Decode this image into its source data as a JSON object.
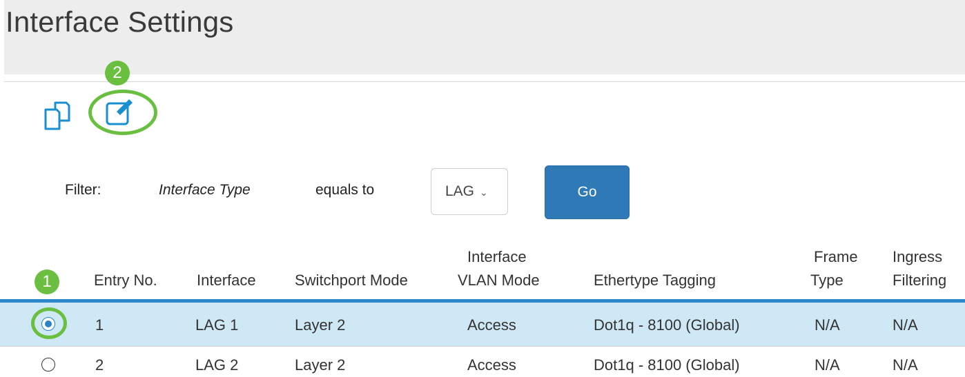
{
  "page": {
    "title": "Interface Settings"
  },
  "toolbar": {
    "copy_icon": "copy-settings-icon",
    "edit_icon": "edit-icon",
    "callout_2": "2"
  },
  "filter": {
    "label": "Filter:",
    "field": "Interface Type",
    "operator": "equals to",
    "selected": "LAG",
    "go_label": "Go"
  },
  "table": {
    "callout_1": "1",
    "headers": {
      "entry_no": "Entry No.",
      "interface": "Interface",
      "switchport_mode": "Switchport Mode",
      "vlan_mode_1": "Interface",
      "vlan_mode_2": "VLAN Mode",
      "ethertype": "Ethertype Tagging",
      "frame_1": "Frame",
      "frame_2": "Type",
      "ingress_1": "Ingress",
      "ingress_2": "Filtering"
    },
    "rows": [
      {
        "entry": "1",
        "interface": "LAG 1",
        "mode": "Layer 2",
        "vlan_mode": "Access",
        "ethertype": "Dot1q - 8100 (Global)",
        "frame_type": "N/A",
        "ingress": "N/A",
        "selected": true
      },
      {
        "entry": "2",
        "interface": "LAG 2",
        "mode": "Layer 2",
        "vlan_mode": "Access",
        "ethertype": "Dot1q - 8100 (Global)",
        "frame_type": "N/A",
        "ingress": "N/A",
        "selected": false
      }
    ]
  },
  "colors": {
    "accent": "#2f79b7",
    "callout": "#6abf40",
    "selected_row": "#cfe8f6",
    "icon": "#1a8fd0"
  }
}
